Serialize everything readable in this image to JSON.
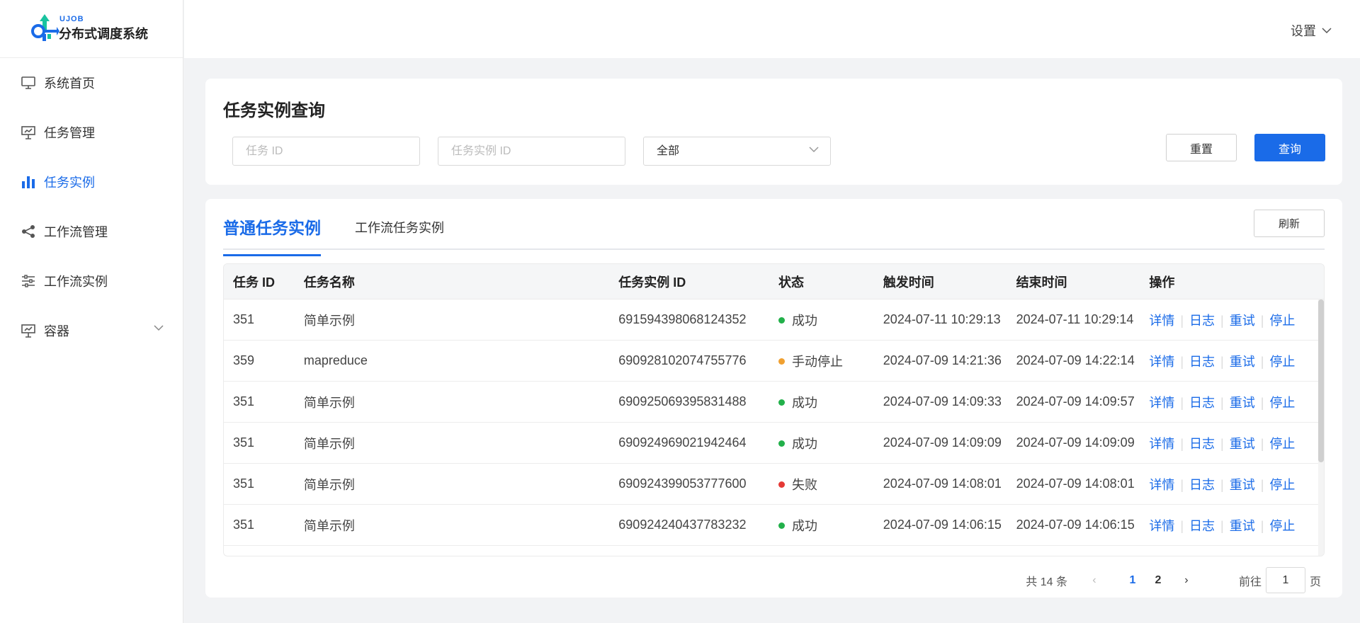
{
  "brand": {
    "top": "UJOB",
    "name": "分布式调度系统"
  },
  "sidebar": {
    "items": [
      {
        "label": "系统首页",
        "icon": "monitor-icon",
        "active": false
      },
      {
        "label": "任务管理",
        "icon": "presentation-board-icon",
        "active": false
      },
      {
        "label": "任务实例",
        "icon": "bar-chart-icon",
        "active": true
      },
      {
        "label": "工作流管理",
        "icon": "share-icon",
        "active": false
      },
      {
        "label": "工作流实例",
        "icon": "sliders-icon",
        "active": false
      },
      {
        "label": "容器",
        "icon": "presentation-board-icon",
        "active": false,
        "expandable": true
      }
    ]
  },
  "header": {
    "settings_label": "设置"
  },
  "query": {
    "title": "任务实例查询",
    "task_id_placeholder": "任务 ID",
    "instance_id_placeholder": "任务实例 ID",
    "status_select": "全部",
    "reset_label": "重置",
    "query_label": "查询"
  },
  "tabs": {
    "active": "普通任务实例",
    "second": "工作流任务实例"
  },
  "refresh_label": "刷新",
  "table": {
    "headers": [
      "任务 ID",
      "任务名称",
      "任务实例 ID",
      "状态",
      "触发时间",
      "结束时间",
      "操作"
    ],
    "rows": [
      {
        "task_id": "351",
        "name": "简单示例",
        "instance_id": "691594398068124352",
        "status": "成功",
        "status_color": "#22b04a",
        "trigger": "2024-07-11 10:29:13",
        "end": "2024-07-11 10:29:14"
      },
      {
        "task_id": "359",
        "name": "mapreduce",
        "instance_id": "690928102074755776",
        "status": "手动停止",
        "status_color": "#f0a030",
        "trigger": "2024-07-09 14:21:36",
        "end": "2024-07-09 14:22:14"
      },
      {
        "task_id": "351",
        "name": "简单示例",
        "instance_id": "690925069395831488",
        "status": "成功",
        "status_color": "#22b04a",
        "trigger": "2024-07-09 14:09:33",
        "end": "2024-07-09 14:09:57"
      },
      {
        "task_id": "351",
        "name": "简单示例",
        "instance_id": "690924969021942464",
        "status": "成功",
        "status_color": "#22b04a",
        "trigger": "2024-07-09 14:09:09",
        "end": "2024-07-09 14:09:09"
      },
      {
        "task_id": "351",
        "name": "简单示例",
        "instance_id": "690924399053777600",
        "status": "失败",
        "status_color": "#e53935",
        "trigger": "2024-07-09 14:08:01",
        "end": "2024-07-09 14:08:01"
      },
      {
        "task_id": "351",
        "name": "简单示例",
        "instance_id": "690924240437783232",
        "status": "成功",
        "status_color": "#22b04a",
        "trigger": "2024-07-09 14:06:15",
        "end": "2024-07-09 14:06:15"
      }
    ],
    "actions": [
      "详情",
      "日志",
      "重试",
      "停止"
    ]
  },
  "pagination": {
    "total_text": "共 14 条",
    "pages": [
      "1",
      "2"
    ],
    "current": "1",
    "goto_label": "前往",
    "goto_value": "1",
    "page_unit": "页"
  }
}
